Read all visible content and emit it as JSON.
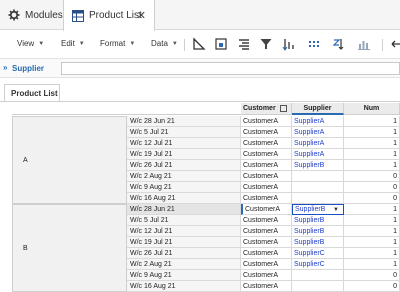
{
  "tabs": {
    "modules_label": "Modules",
    "product_label": "Product List",
    "close_glyph": "✕",
    "modules_icon": "gear-icon",
    "product_icon": "grid-table-icon"
  },
  "toolbar": {
    "menus": [
      "View",
      "Edit",
      "Format",
      "Data"
    ],
    "icons": [
      "triangle-ruler-icon",
      "frame-icon",
      "align-right-icon",
      "filter-icon",
      "sort-icon",
      "grid-dots-icon",
      "sort-az-icon",
      "bar-chart-icon",
      "undo-icon"
    ]
  },
  "filter": {
    "label": "Supplier",
    "icon": "double-chevron-down-icon",
    "value": ""
  },
  "section": {
    "title": "Product List"
  },
  "grid": {
    "headers": {
      "customer": "Customer",
      "supplier": "Supplier",
      "num": "Num"
    },
    "accent_color": "#2a6ab0",
    "groups": [
      {
        "label": "A",
        "rows": [
          {
            "week": "W/c 28 Jun 21",
            "customer": "CustomerA",
            "supplier": "SupplierA",
            "num": "1"
          },
          {
            "week": "W/c 5 Jul 21",
            "customer": "CustomerA",
            "supplier": "SupplierA",
            "num": "1"
          },
          {
            "week": "W/c 12 Jul 21",
            "customer": "CustomerA",
            "supplier": "SupplierA",
            "num": "1"
          },
          {
            "week": "W/c 19 Jul 21",
            "customer": "CustomerA",
            "supplier": "SupplierA",
            "num": "1"
          },
          {
            "week": "W/c 26 Jul 21",
            "customer": "CustomerA",
            "supplier": "SupplierB",
            "num": "1"
          },
          {
            "week": "W/c 2 Aug 21",
            "customer": "CustomerA",
            "supplier": "",
            "num": "0"
          },
          {
            "week": "W/c 9 Aug 21",
            "customer": "CustomerA",
            "supplier": "",
            "num": "0"
          },
          {
            "week": "W/c 16 Aug 21",
            "customer": "CustomerA",
            "supplier": "",
            "num": "0"
          }
        ]
      },
      {
        "label": "B",
        "rows": [
          {
            "week": "W/c 28 Jun 21",
            "customer": "CustomerA",
            "supplier": "SupplierB",
            "num": "1",
            "selected": true
          },
          {
            "week": "W/c 5 Jul 21",
            "customer": "CustomerA",
            "supplier": "SupplierB",
            "num": "1"
          },
          {
            "week": "W/c 12 Jul 21",
            "customer": "CustomerA",
            "supplier": "SupplierB",
            "num": "1"
          },
          {
            "week": "W/c 19 Jul 21",
            "customer": "CustomerA",
            "supplier": "SupplierB",
            "num": "1"
          },
          {
            "week": "W/c 26 Jul 21",
            "customer": "CustomerA",
            "supplier": "SupplierC",
            "num": "1"
          },
          {
            "week": "W/c 2 Aug 21",
            "customer": "CustomerA",
            "supplier": "SupplierC",
            "num": "1"
          },
          {
            "week": "W/c 9 Aug 21",
            "customer": "CustomerA",
            "supplier": "",
            "num": "0"
          },
          {
            "week": "W/c 16 Aug 21",
            "customer": "CustomerA",
            "supplier": "",
            "num": "0"
          }
        ]
      }
    ]
  }
}
